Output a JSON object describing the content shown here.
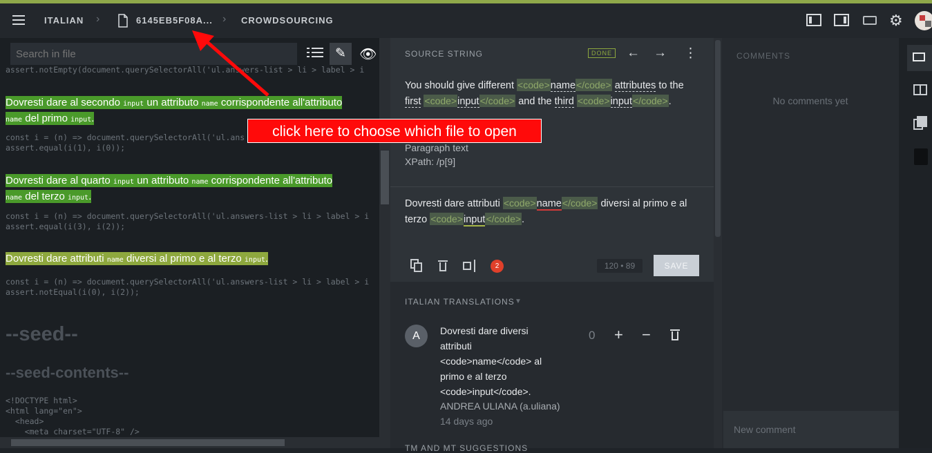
{
  "breadcrumb": {
    "project": "ITALIAN",
    "file": "6145EB5F08A...",
    "section": "CROWDSOURCING"
  },
  "search": {
    "placeholder": "Search in file"
  },
  "editor": {
    "line0": "assert.notEmpty(document.querySelectorAll('ul.answers-list > li > label > i",
    "s1_a": "Dovresti dare al secondo ",
    "s1_b": "input",
    "s1_c": " un attributo ",
    "s1_d": "name",
    "s1_e": " corrispondente all'attributo",
    "s1_f": "name",
    "s1_g": " del primo ",
    "s1_h": "input",
    "s1_i": ".",
    "code1": "const i = (n) => document.querySelectorAll('ul.ans",
    "code2": "assert.equal(i(1), i(0));",
    "s2_a": "Dovresti dare al quarto ",
    "s2_b": "input",
    "s2_c": " un attributo ",
    "s2_d": "name",
    "s2_e": " corrispondente all'attributo",
    "s2_f": "name",
    "s2_g": " del terzo ",
    "s2_h": "input",
    "s2_i": ".",
    "code3": "const i = (n) => document.querySelectorAll('ul.answers-list > li > label > i",
    "code4": "assert.equal(i(3), i(2));",
    "s3_a": "Dovresti dare attributi ",
    "s3_b": "name",
    "s3_c": " diversi al primo e al terzo ",
    "s3_d": "input",
    "s3_e": ".",
    "code5": "const i = (n) => document.querySelectorAll('ul.answers-list > li > label > i",
    "code6": "assert.notEqual(i(0), i(2));",
    "head1": "--seed--",
    "head2": "--seed-contents--",
    "code7": "<!DOCTYPE html>",
    "code8": "<html lang=\"en\">",
    "code9": "  <head>",
    "code10": "    <meta charset=\"UTF-8\" />"
  },
  "source": {
    "label": "SOURCE STRING",
    "status": "DONE",
    "text1": "You should give different ",
    "tag_open": "<code>",
    "tag_close": "</code>",
    "w_name": "name",
    "text2": " ",
    "w_attributes": "attributes",
    "text3": " to the",
    "w_first": "first",
    "text4": " ",
    "w_input": "input",
    "text5": " and the ",
    "w_third": "third",
    "text6": " ",
    "text7": ".",
    "context_type": "Paragraph text",
    "xpath": "XPath: /p[9]"
  },
  "translation_edit": {
    "t1": "Dovresti dare attributi ",
    "w_name": "name",
    "t2": " diversi al primo e al",
    "t3": "terzo ",
    "w_input": "input",
    "t4": ".",
    "issues_count": "2",
    "size": "120 • 89",
    "save_label": "SAVE"
  },
  "translations": {
    "header": "ITALIAN TRANSLATIONS",
    "item": {
      "avatar": "A",
      "line1": "Dovresti dare diversi",
      "line2": "attributi",
      "line3": "<code>name</code> al",
      "line4": "primo e al terzo",
      "line5": "<code>input</code>.",
      "author": "ANDREA ULIANA (a.uliana)",
      "time": "14 days ago",
      "votes": "0"
    },
    "next_header": "TM AND MT SUGGESTIONS"
  },
  "comments": {
    "label": "COMMENTS",
    "empty": "No comments yet",
    "placeholder": "New comment"
  },
  "annotation": {
    "text": "click here to choose which file to open"
  },
  "colors": {
    "accent_strip": "#8fa84a",
    "highlight_green": "#4a9a2a",
    "highlight_olive": "#8ea83e",
    "callout_red": "#ff0a0a"
  }
}
